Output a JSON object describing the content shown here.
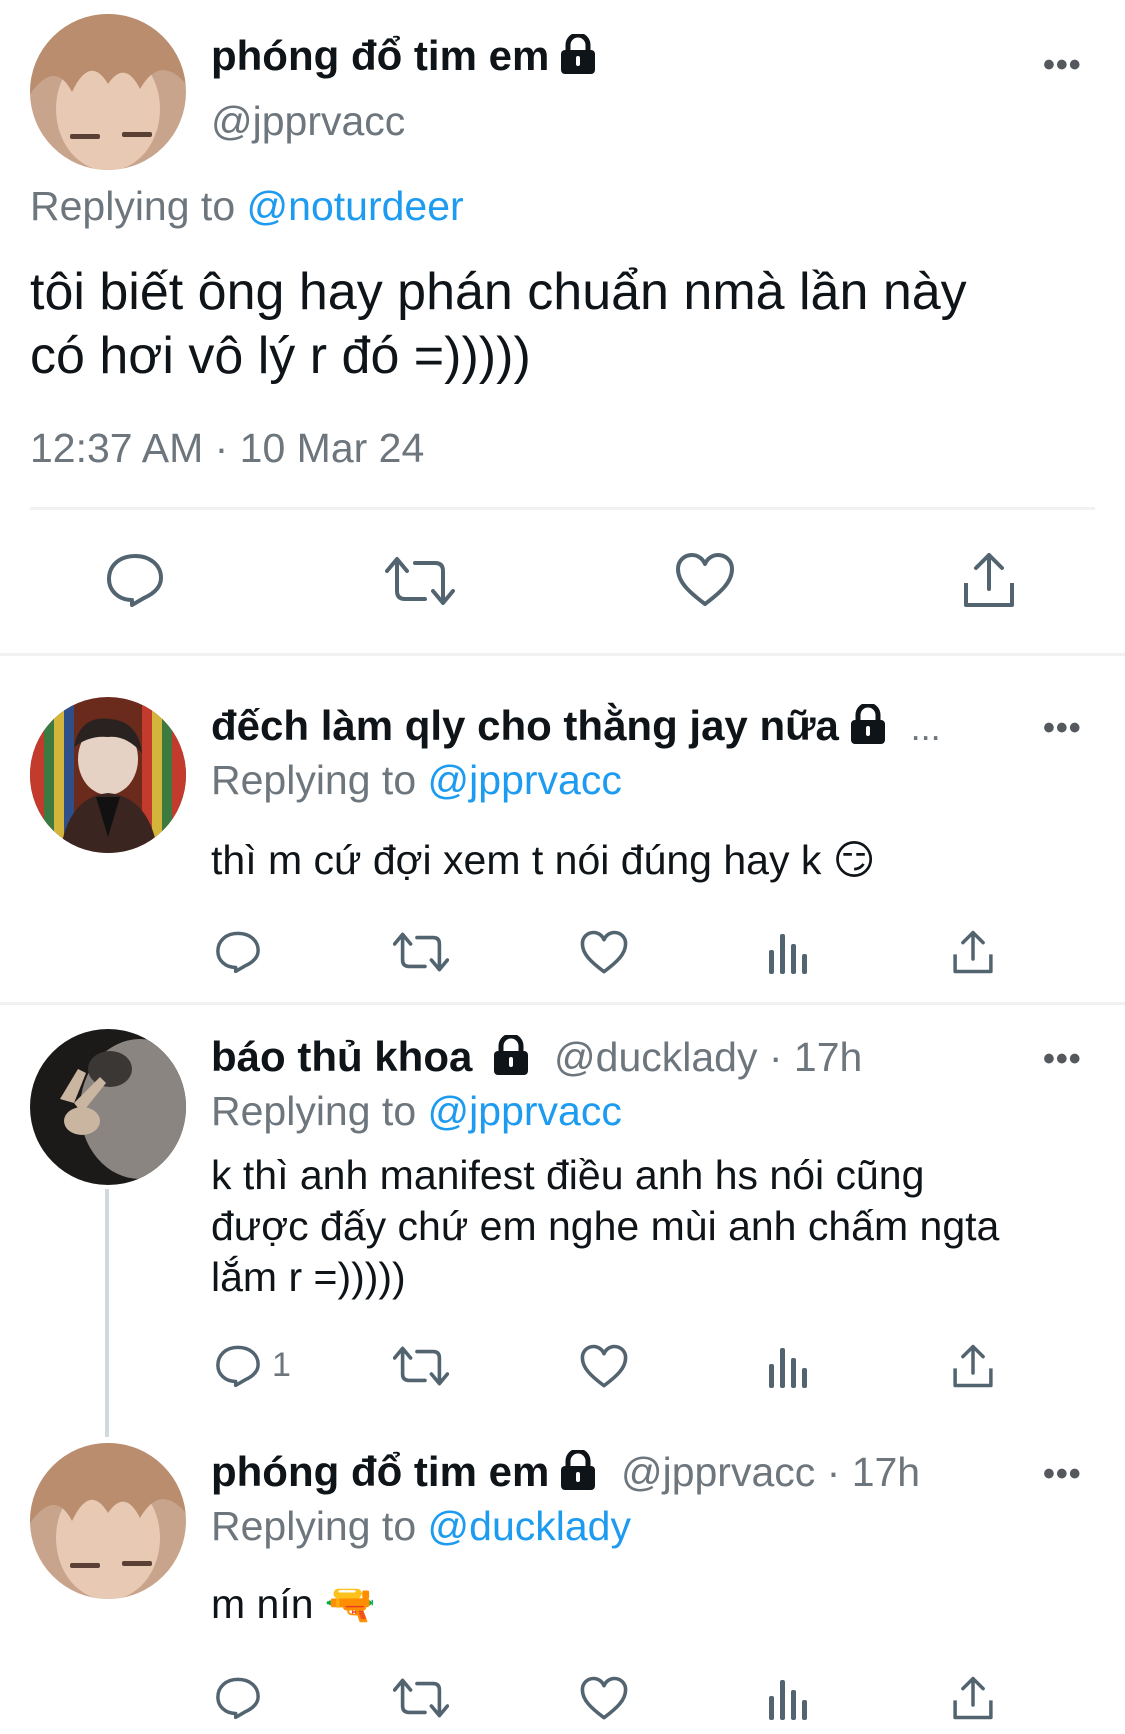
{
  "main_tweet": {
    "display_name": "phóng đổ tim em",
    "handle": "@jpprvacc",
    "replying_prefix": "Replying to",
    "replying_to": "@noturdeer",
    "text_line1": "tôi biết ông hay phán chuẩn nmà lần này",
    "text_line2": "có hơi vô lý r đó =)))))",
    "timestamp": "12:37 AM · 10 Mar 24",
    "more_label": "•••"
  },
  "replies": [
    {
      "display_name": "đếch làm qly cho thằng jay nữa",
      "overflow": "...",
      "replying_prefix": "Replying to",
      "replying_to": "@jpprvacc",
      "text": "thì m cứ đợi xem t nói đúng hay k 😏",
      "more_label": "•••"
    },
    {
      "display_name": "báo thủ khoa",
      "meta": "@ducklady · 17h",
      "replying_prefix": "Replying to",
      "replying_to": "@jpprvacc",
      "text_line1": "k thì anh manifest điều anh hs nói cũng",
      "text_line2": "được đấy chứ em nghe mùi anh chấm ngta",
      "text_line3": "lắm r =)))))",
      "reply_count": "1",
      "more_label": "•••"
    },
    {
      "display_name": "phóng đổ tim em",
      "meta": "@jpprvacc · 17h",
      "replying_prefix": "Replying to",
      "replying_to": "@ducklady",
      "text": "m nín 🔫",
      "more_label": "•••"
    }
  ],
  "colors": {
    "link": "#1d9bf0",
    "secondary_text": "#6e767d",
    "icon": "#536471"
  }
}
